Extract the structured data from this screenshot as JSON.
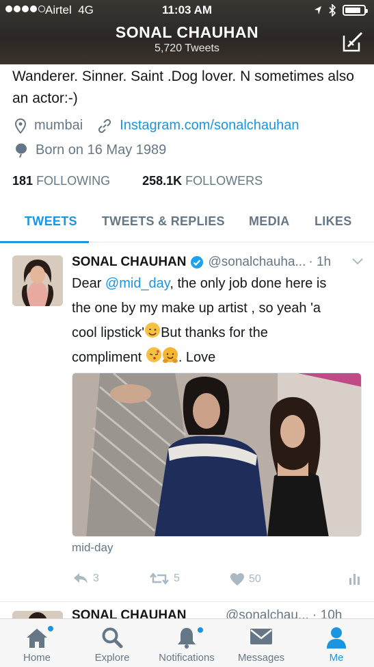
{
  "status_bar": {
    "carrier": "Airtel",
    "network": "4G",
    "time": "11:03 AM"
  },
  "header": {
    "name": "SONAL CHAUHAN",
    "tweet_count": "5,720 Tweets"
  },
  "profile": {
    "bio": "Wanderer. Sinner. Saint .Dog lover. N sometimes also an actor:-)",
    "location": "mumbai",
    "website": "Instagram.com/sonalchauhan",
    "birthday": "Born on 16 May 1989",
    "following_count": "181",
    "following_label": "FOLLOWING",
    "followers_count": "258.1K",
    "followers_label": "FOLLOWERS"
  },
  "tabs": [
    {
      "label": "TWEETS",
      "active": true
    },
    {
      "label": "TWEETS & REPLIES",
      "active": false
    },
    {
      "label": "MEDIA",
      "active": false
    },
    {
      "label": "LIKES",
      "active": false
    }
  ],
  "tweet": {
    "author_name": "SONAL CHAUHAN",
    "handle": "@sonalchauha...",
    "time": "· 1h",
    "text_pre_mention": "Dear ",
    "mention": "@mid_day",
    "text_line1_rest": ", the only job done here is",
    "text_line2": "the one by my make up artist , so yeah 'a",
    "text_line3_a": "cool lipstick'",
    "text_line3_b": "But thanks for the",
    "text_line4_a": "compliment ",
    "text_line4_b": ". Love",
    "media_source": "mid-day",
    "replies": "3",
    "retweets": "5",
    "likes": "50"
  },
  "next_tweet": {
    "author_name": "SONAL CHAUHAN",
    "handle": "@sonalchau... · 10h"
  },
  "tabbar": [
    {
      "label": "Home"
    },
    {
      "label": "Explore"
    },
    {
      "label": "Notifications"
    },
    {
      "label": "Messages"
    },
    {
      "label": "Me"
    }
  ],
  "colors": {
    "accent": "#1b95e0",
    "muted": "#657786",
    "verified": "#1da1f2"
  },
  "icons": [
    "location-pin-icon",
    "link-icon",
    "balloon-icon",
    "verified-badge-icon",
    "chevron-down-icon",
    "reply-icon",
    "retweet-icon",
    "heart-icon",
    "analytics-icon",
    "compose-icon",
    "home-icon",
    "search-icon",
    "bell-icon",
    "envelope-icon",
    "person-icon"
  ]
}
